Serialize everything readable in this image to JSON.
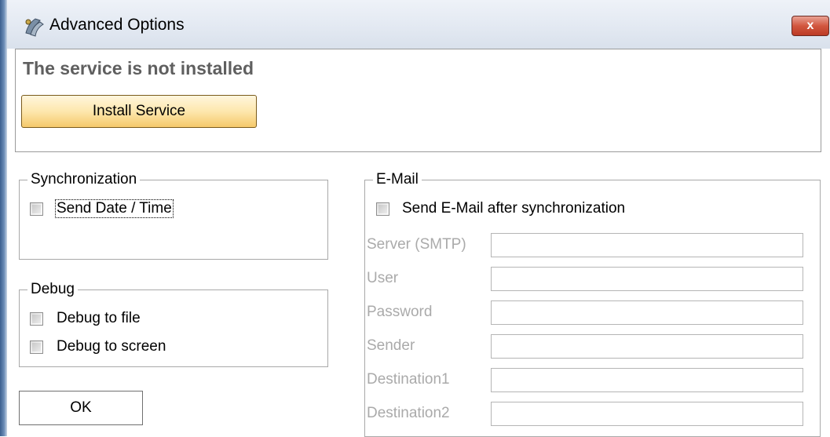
{
  "window": {
    "title": "Advanced Options",
    "close_label": "x"
  },
  "service": {
    "status_text": "The service is not installed",
    "install_button": "Install Service"
  },
  "synchronization": {
    "legend": "Synchronization",
    "send_datetime_label": "Send Date / Time",
    "send_datetime_checked": false
  },
  "debug": {
    "legend": "Debug",
    "to_file_label": "Debug to file",
    "to_file_checked": false,
    "to_screen_label": "Debug to screen",
    "to_screen_checked": false
  },
  "email": {
    "legend": "E-Mail",
    "send_after_sync_label": "Send E-Mail after synchronization",
    "send_after_sync_checked": false,
    "fields": [
      {
        "label": "Server (SMTP)",
        "value": ""
      },
      {
        "label": "User",
        "value": ""
      },
      {
        "label": "Password",
        "value": ""
      },
      {
        "label": "Sender",
        "value": ""
      },
      {
        "label": "Destination1",
        "value": ""
      },
      {
        "label": "Destination2",
        "value": ""
      }
    ]
  },
  "footer": {
    "ok_button": "OK"
  },
  "colors": {
    "disabled_text": "#aaaaaa",
    "status_text": "#5f5f5f",
    "close_button": "#c9462f"
  },
  "icons": [
    "app-icon",
    "close-icon"
  ]
}
